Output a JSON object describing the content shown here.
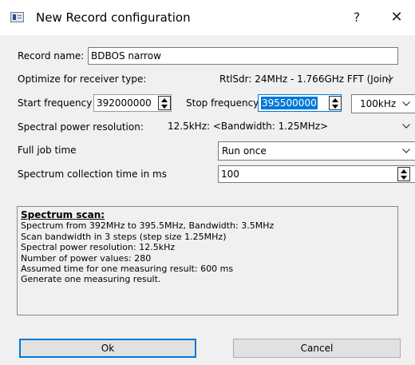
{
  "window": {
    "title": "New Record configuration",
    "help_glyph": "?",
    "close_glyph": "✕",
    "icon": "app-window-icon"
  },
  "form": {
    "record_name_label": "Record name:",
    "record_name_value": "BDBOS narrow",
    "optimize_label": "Optimize for receiver type:",
    "optimize_value": "RtlSdr: 24MHz - 1.766GHz FFT (Join)",
    "start_label": "Start frequency",
    "start_value": "392000000",
    "stop_label": "Stop frequency",
    "stop_value": "395500000",
    "step_value": "100kHz",
    "resolution_label": "Spectral power resolution:",
    "resolution_value": "12.5kHz: <Bandwidth: 1.25MHz>",
    "job_time_label": "Full job time",
    "job_time_value": "Run once",
    "collection_label": "Spectrum collection time in ms",
    "collection_value": "100"
  },
  "info": {
    "heading": "Spectrum scan:",
    "lines": [
      "Spectrum from 392MHz to 395.5MHz, Bandwidth: 3.5MHz",
      "Scan bandwidth in 3 steps (step size 1.25MHz)",
      "Spectral power resolution: 12.5kHz",
      "Number of power values: 280",
      "Assumed time for one measuring result: 600 ms",
      "Generate one measuring result."
    ]
  },
  "buttons": {
    "ok": "Ok",
    "cancel": "Cancel"
  },
  "colors": {
    "accent": "#0078d7",
    "dialog_bg": "#f0f0f0"
  }
}
